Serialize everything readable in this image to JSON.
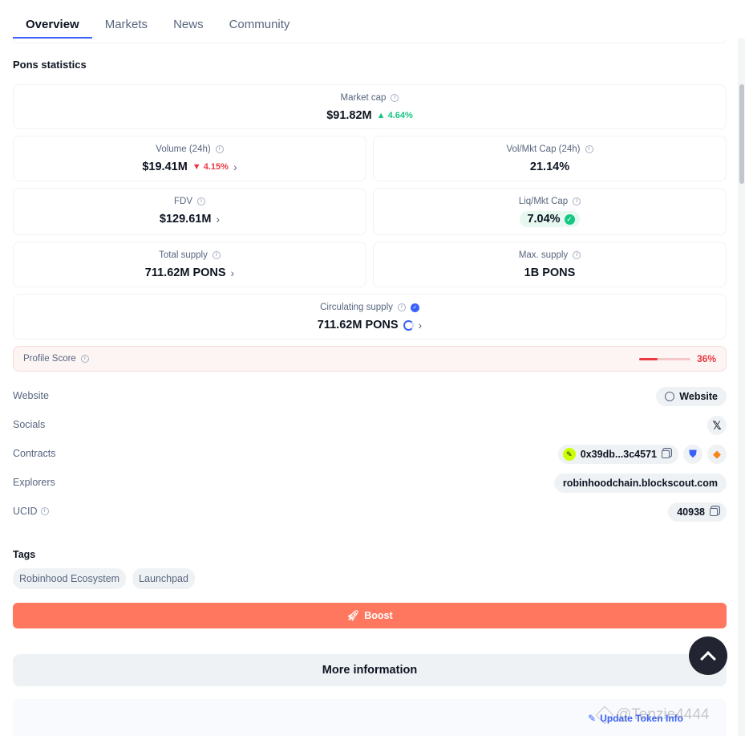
{
  "tabs": [
    {
      "label": "Overview",
      "active": true
    },
    {
      "label": "Markets",
      "active": false
    },
    {
      "label": "News",
      "active": false
    },
    {
      "label": "Community",
      "active": false
    }
  ],
  "stats": {
    "title": "Pons statistics",
    "market_cap": {
      "label": "Market cap",
      "value": "$91.82M",
      "change": "4.64%",
      "direction": "up"
    },
    "volume": {
      "label": "Volume (24h)",
      "value": "$19.41M",
      "change": "4.15%",
      "direction": "down"
    },
    "vol_mkt_cap": {
      "label": "Vol/Mkt Cap (24h)",
      "value": "21.14%"
    },
    "fdv": {
      "label": "FDV",
      "value": "$129.61M"
    },
    "liq_mkt_cap": {
      "label": "Liq/Mkt Cap",
      "value": "7.04%"
    },
    "total_supply": {
      "label": "Total supply",
      "value": "711.62M PONS"
    },
    "max_supply": {
      "label": "Max. supply",
      "value": "1B PONS"
    },
    "circulating_supply": {
      "label": "Circulating supply",
      "value": "711.62M PONS"
    }
  },
  "profile_score": {
    "label": "Profile Score",
    "value": "36%",
    "fraction": 0.36
  },
  "info_rows": {
    "website": {
      "label": "Website",
      "value": "Website"
    },
    "socials": {
      "label": "Socials"
    },
    "contracts": {
      "label": "Contracts",
      "value": "0x39db...3c4571"
    },
    "explorers": {
      "label": "Explorers",
      "value": "robinhoodchain.blockscout.com"
    },
    "ucid": {
      "label": "UCID",
      "value": "40938"
    }
  },
  "tags": {
    "title": "Tags",
    "items": [
      "Robinhood Ecosystem",
      "Launchpad"
    ]
  },
  "boost": {
    "label": "Boost"
  },
  "more_info": {
    "label": "More information"
  },
  "update": {
    "label": "Update Token Info"
  },
  "watermark": {
    "text": "@Tenzie4444"
  },
  "colors": {
    "accent": "#3861fb",
    "up": "#16c784",
    "down": "#ea3943",
    "boost": "#ff775f",
    "scroll_top_bg": "#222531"
  }
}
